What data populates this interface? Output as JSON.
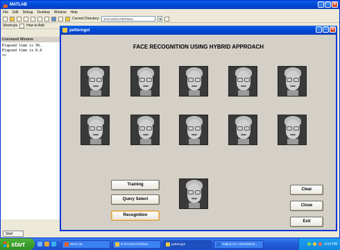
{
  "matlab": {
    "title": "MATLAB",
    "menu": [
      "File",
      "Edit",
      "Debug",
      "Desktop",
      "Window",
      "Help"
    ],
    "current_directory_label": "Current Directory:",
    "current_directory_value": "D:\\FACE\\CITE\\FINAL",
    "shortcuts": [
      "Shortcuts",
      "How to Add"
    ],
    "command_window_title": "Command Window",
    "command_lines": [
      "Elapsed time is 50.",
      "Elapsed time is 0.4",
      ">>"
    ],
    "start_tab": "Start"
  },
  "figure": {
    "title": "petterngui",
    "heading": "FACE RECOGNITION USING HYBRID APPROACH",
    "face_icon": "face-photo",
    "buttons": {
      "training": "Training",
      "query_select": "Query Select",
      "recognition": "Recognition",
      "clear": "Clear",
      "close": "Close",
      "exit": "Exit"
    }
  },
  "taskbar": {
    "start": "start",
    "tasks": [
      "MATLAB",
      "D:\\FACE\\CITE\\final...",
      "petterngui",
      "TABLE OF CONTENTS..."
    ],
    "clock": "4:10 PM"
  },
  "colors": {
    "xp_title": "#0054e3",
    "taskbar": "#245edb",
    "start_green": "#3c9a2e",
    "dialog_face": "#d4d0c8"
  }
}
